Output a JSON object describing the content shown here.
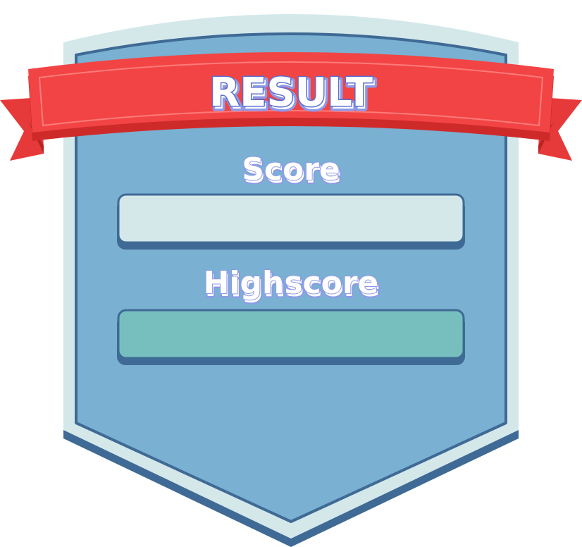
{
  "banner": {
    "title": "RESULT"
  },
  "score": {
    "label": "Score",
    "value": ""
  },
  "highscore": {
    "label": "Highscore",
    "value": ""
  },
  "colors": {
    "shield_outer": "#d4e8ea",
    "shield_inner": "#7ab0d1",
    "shield_border": "#3f6a95",
    "ribbon": "#f24444",
    "ribbon_dark": "#cf2a2a",
    "ribbon_tail": "#e83a3a",
    "score_field": "#d4e8ea",
    "highscore_field": "#76bfbe",
    "label_shadow": "#8d99e8"
  }
}
